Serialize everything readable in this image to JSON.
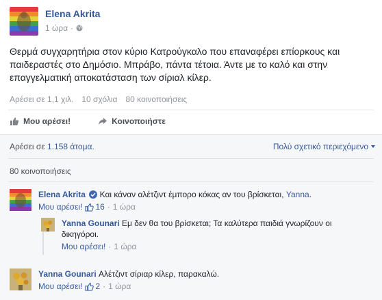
{
  "post": {
    "author": "Elena Akrita",
    "time": "1 ώρα",
    "separator": "·",
    "text": "Θερμά συγχαρητήρια στον κύριο Κατρούγκαλο που επαναφέρει επίορκους και παιδεραστές στο Δημόσιο. Μπράβο, πάντα τέτοια. Άντε με το καλό και στην επαγγελματική αποκατάσταση των σίριαλ κίλερ.",
    "stats": {
      "likes": "Αρέσει σε 1,1 χιλ.",
      "comments": "10 σχόλια",
      "shares": "80 κοινοποιήσεις"
    }
  },
  "actions": {
    "like_label": "Μου αρέσει!",
    "share_label": "Κοινοποιήστε"
  },
  "ufi": {
    "likes_prefix": "Αρέσει σε ",
    "likes_link": "1.158 άτομα",
    "likes_suffix": ".",
    "relevance_label": "Πολύ σχετικό περιεχόμενο",
    "shares": "80 κοινοποιήσεις"
  },
  "comments": [
    {
      "author": "Elena Akrita",
      "text": "Και κάναν αλέτζιντ έμπορο κόκας αν του βρίσκεται, ",
      "mention": "Yanna",
      "mention_suffix": ".",
      "like_label": "Μου αρέσει!",
      "like_count": "16",
      "time": "1 ώρα",
      "separator": "·"
    },
    {
      "author": "Yanna Gounari",
      "text": "Εμ δεν θα του βρίσκεται; Τα καλύτερα παιδιά γνωρίζουν οι δικηγόροι.",
      "like_label": "Μου αρέσει!",
      "time": "1 ώρα",
      "separator": "·"
    },
    {
      "author": "Yanna Gounari",
      "text": "Αλέτζιντ σίριαρ κίλερ, παρακαλώ.",
      "like_label": "Μου αρέσει!",
      "like_count": "2",
      "time": "1 ώρα",
      "separator": "·"
    }
  ],
  "colors": {
    "link": "#365899",
    "muted": "#90949c",
    "ufi_bg": "#f6f7f9"
  }
}
